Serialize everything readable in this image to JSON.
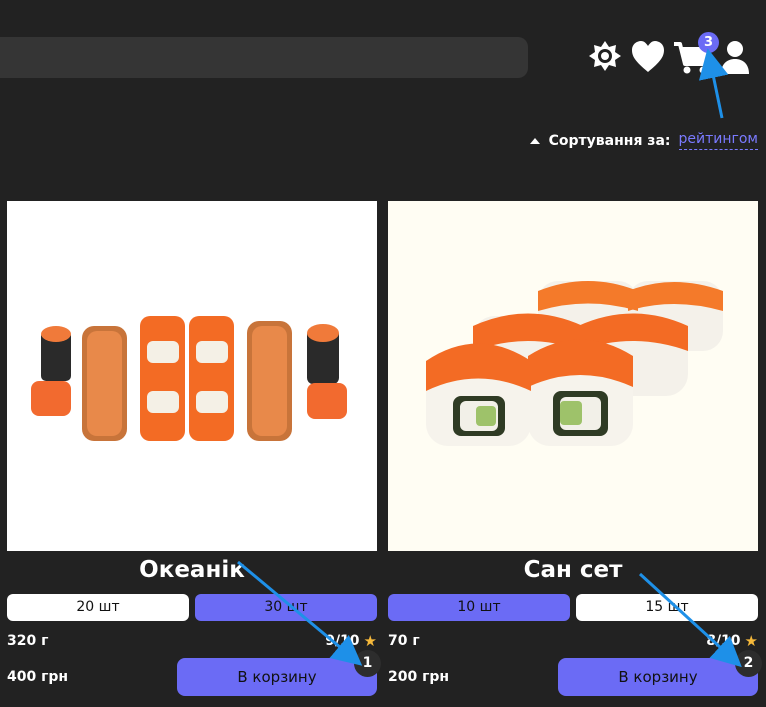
{
  "header": {
    "search": {
      "placeholder": ""
    },
    "icons": [
      "settings-icon",
      "heart-icon",
      "cart-icon",
      "user-icon"
    ],
    "cart_count": "3"
  },
  "sort": {
    "label": "Сортування за:",
    "value": "рейтингом"
  },
  "products": [
    {
      "name": "Океанік",
      "sizes": [
        "20 шт",
        "30 шт"
      ],
      "selected_size": "30 шт",
      "weight": "320 г",
      "rating": "9/10",
      "price": "400 грн",
      "buy_label": "В корзину",
      "step": "1"
    },
    {
      "name": "Сан сет",
      "sizes": [
        "10 шт",
        "15 шт"
      ],
      "selected_size": "10 шт",
      "weight": "70 г",
      "rating": "8/10",
      "price": "200 грн",
      "buy_label": "В корзину",
      "step": "2"
    }
  ],
  "colors": {
    "accent": "#6b6bf5",
    "background": "#222222",
    "annotation_arrow": "#1e90e8",
    "star": "#f6b93b"
  }
}
